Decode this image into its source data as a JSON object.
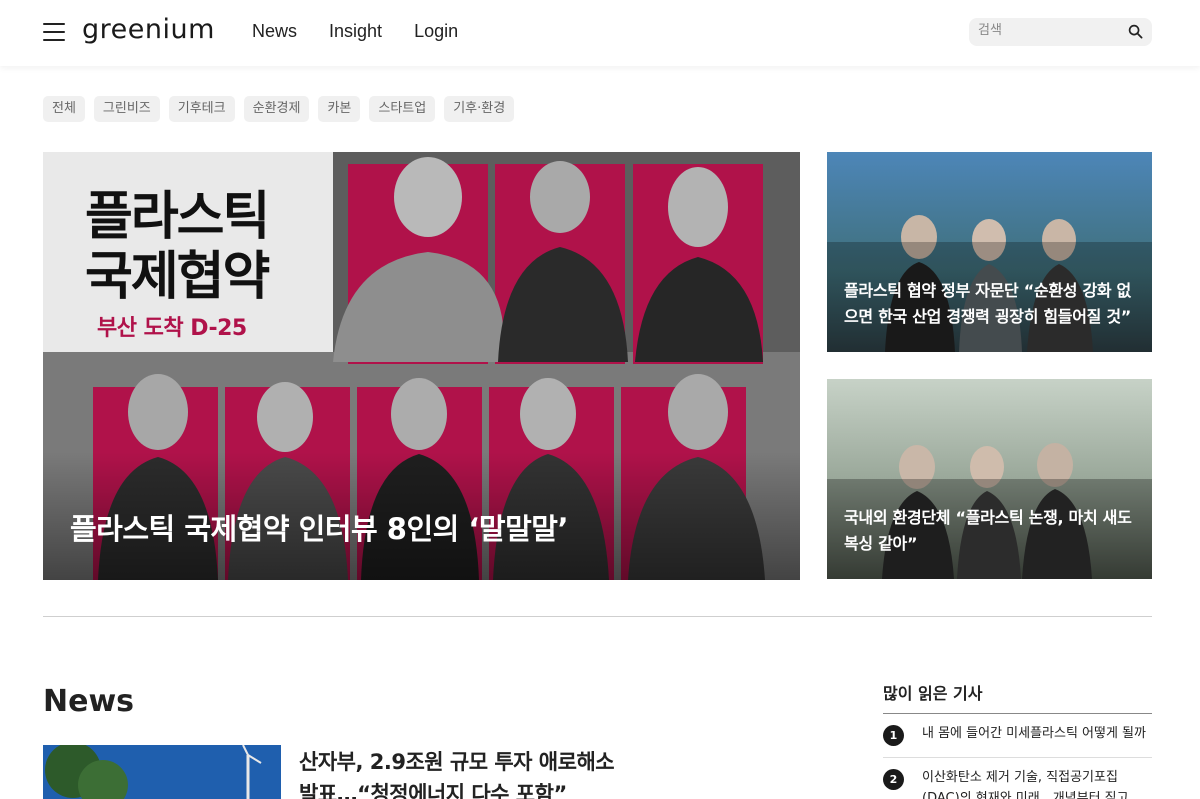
{
  "header": {
    "logo": "greenium",
    "nav": [
      "News",
      "Insight",
      "Login"
    ],
    "search_placeholder": "검색"
  },
  "categories": [
    "전체",
    "그린비즈",
    "기후테크",
    "순환경제",
    "카본",
    "스타트업",
    "기후·환경"
  ],
  "hero": {
    "title": "플라스틱 국제협약 인터뷰 8인의 ‘말말말’",
    "poster_line1": "플라스틱",
    "poster_line2": "국제협약",
    "poster_sub": "부산 도착 D-25"
  },
  "side_articles": [
    {
      "title": "플라스틱 협약 정부 자문단 “순환성 강화 없으면 한국 산업 경쟁력 굉장히 힘들어질 것”"
    },
    {
      "title": "국내외 환경단체 “플라스틱 논쟁, 마치 새도복싱 같아”"
    }
  ],
  "news": {
    "heading": "News",
    "first_title": "산자부, 2.9조원 규모 투자 애로해소 발표…“청정에너지 다수 포함”"
  },
  "popular": {
    "heading": "많이 읽은 기사",
    "items": [
      {
        "rank": "1",
        "title": "내 몸에 들어간 미세플라스틱 어떻게 될까"
      },
      {
        "rank": "2",
        "title": "이산화탄소 제거 기술, 직접공기포집(DAC)의 현재와 미래…개념부터 짚고"
      }
    ]
  },
  "colors": {
    "accent_red": "#b0124a",
    "chip_bg": "#f0f0f0",
    "text": "#222222"
  }
}
